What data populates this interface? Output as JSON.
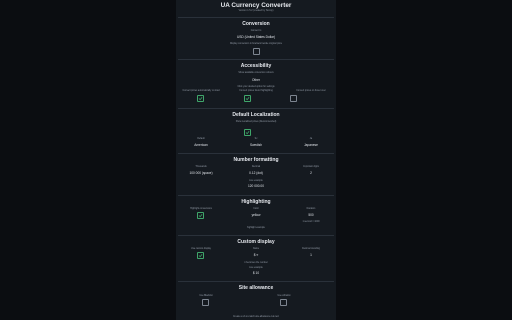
{
  "app": {
    "title": "UA Currency Converter",
    "version": "Version 1.5.2 (created by Scoop)"
  },
  "conversion": {
    "title": "Conversion",
    "currency_label": "Convert to",
    "currency_value": "USD (United States Dollar)",
    "display_label": "Display conversion in brackets beside original price",
    "display_checked": false
  },
  "accessibility": {
    "title": "Accessibility",
    "color_label": "Show available conversion colours",
    "color_value": "Other",
    "note": "Click your desired option for settings",
    "options": [
      {
        "label": "Convert prices automatically on load",
        "checked": true
      },
      {
        "label": "Convert prices found highlighting",
        "checked": true
      },
      {
        "label": "Convert prices on hover over",
        "checked": false
      }
    ]
  },
  "localization": {
    "title": "Default Localization",
    "sub_label": "Show Localized prices (Recommended)",
    "sub_checked": true,
    "columns": [
      {
        "label": "Default",
        "value": "American"
      },
      {
        "label": "Sv",
        "value": "Swedish"
      },
      {
        "label": "Ja",
        "value": "Japanese"
      }
    ]
  },
  "number_formatting": {
    "title": "Number formatting",
    "columns": [
      {
        "label": "Thousands",
        "value": "100 000 (space)"
      },
      {
        "label": "Decimal",
        "value": "0.12 (dot)"
      },
      {
        "label": "Important digits",
        "value": "2"
      }
    ],
    "example_label": "Live example",
    "example_value": "120 000.00"
  },
  "highlighting": {
    "title": "Highlighting",
    "enabled_label": "Highlight conversions",
    "enabled_checked": true,
    "color_label": "Color",
    "color_value": "yellow",
    "duration_label": "Duration",
    "duration_value": "500",
    "duration_hint": "1 second = 1000",
    "example_label": "highlight example"
  },
  "custom_display": {
    "title": "Custom display",
    "enabled_label": "Use custom display",
    "enabled_checked": true,
    "name_label": "Name",
    "name_value": "$ ¤",
    "rounding_label": "Decimal rounding",
    "rounding_value": "1",
    "hint": "¤ becomes the number",
    "example_label": "Live example",
    "example_value": "$ 10"
  },
  "site_allowance": {
    "title": "Site allowance",
    "options": [
      {
        "label": "Use Blacklist",
        "checked": false
      },
      {
        "label": "Use whitelist",
        "checked": false
      }
    ],
    "footer": "Create a url-to-match-site-allowance-rule text"
  },
  "colors": {
    "background": "#0b0d11",
    "panel": "#151a20",
    "text": "#d4d8de",
    "check": "#3fa66a"
  }
}
